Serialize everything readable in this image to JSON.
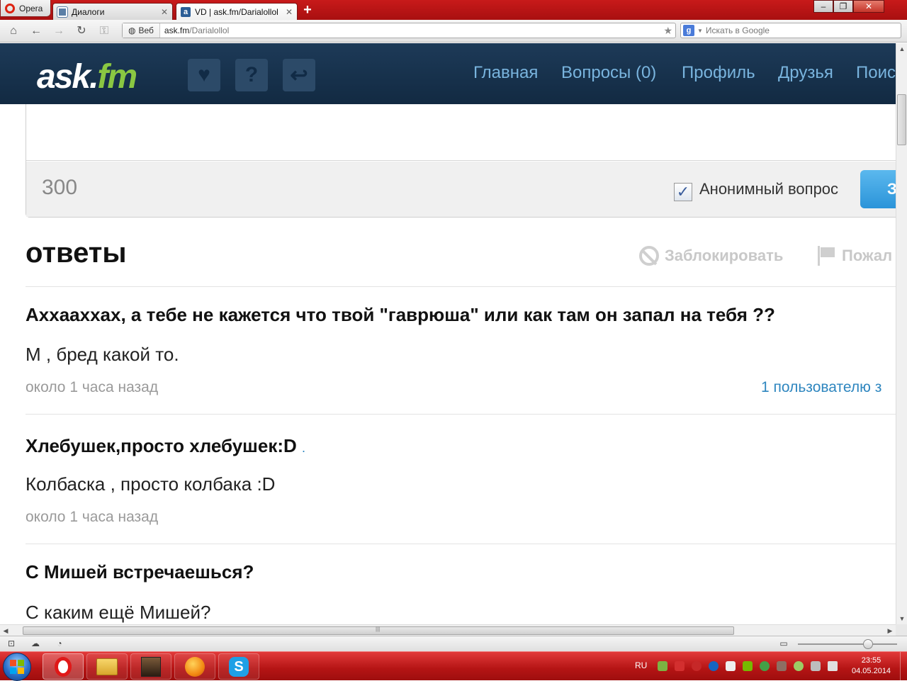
{
  "browser": {
    "menu_label": "Opera",
    "tabs": [
      {
        "label": "Диалоги",
        "active": false
      },
      {
        "label": "VD | ask.fm/Darialollol",
        "active": true
      }
    ],
    "newtab_label": "+",
    "window_controls": {
      "minimize": "–",
      "maximize": "❐",
      "close": "✕"
    },
    "web_badge": "Веб",
    "url_host": "ask.fm",
    "url_path": "/Darialollol",
    "search_placeholder": "Искать в Google",
    "search_engine_letter": "g"
  },
  "site": {
    "logo_main": "ask.",
    "logo_accent": "fm",
    "nav": [
      "Главная",
      "Вопросы (0)",
      "Профиль",
      "Друзья",
      "Поис"
    ],
    "icons": [
      "heart-icon",
      "question-icon",
      "reply-icon"
    ]
  },
  "composer": {
    "char_counter": "300",
    "anonymous_label": "Анонимный вопрос",
    "anonymous_checked": true,
    "submit_label": "З"
  },
  "answers": {
    "title": "ответы",
    "block_label": "Заблокировать",
    "report_label": "Пожал",
    "items": [
      {
        "question": "Аххааххах, а тебе не кажется что твой \"гаврюша\" или как там он запал на тебя ??",
        "answer": "М , бред какой то.",
        "time": "около 1 часа назад",
        "likes": "1 пользователю з",
        "question_suffix": ""
      },
      {
        "question": "Хлебушек,просто хлебушек:D",
        "answer": "Колбаска , просто колбака :D",
        "time": "около 1 часа назад",
        "likes": "",
        "question_suffix": "."
      },
      {
        "question": "С Мишей встречаешься?",
        "answer": "С каким ещё Мишей?",
        "time": "",
        "likes": "",
        "question_suffix": ""
      }
    ]
  },
  "taskbar": {
    "language": "RU",
    "time": "23:55",
    "date": "04.05.2014",
    "apps": [
      "opera",
      "explorer",
      "game",
      "firefox",
      "skype"
    ]
  },
  "colors": {
    "opera_red": "#b41414",
    "askfm_header": "#1a3552",
    "askfm_nav": "#79b4de",
    "askfm_logo_accent": "#8ac742",
    "link_blue": "#2e86bf",
    "button_blue": "#2b94d9"
  }
}
